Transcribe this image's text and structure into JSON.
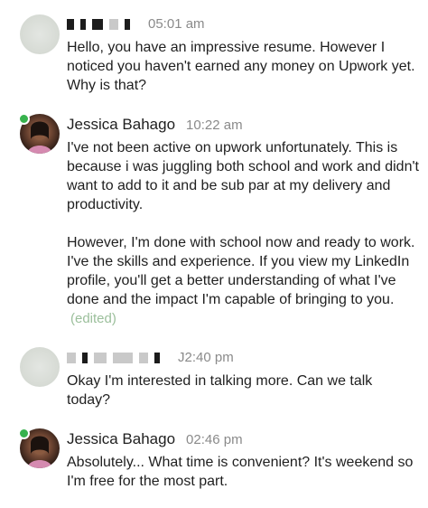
{
  "messages": [
    {
      "sender": "",
      "time": "05:01 am",
      "paragraphs": [
        "Hello, you have an impressive resume. However I noticed you haven't earned any money on Upwork yet. Why is that?"
      ]
    },
    {
      "sender": "Jessica Bahago",
      "time": "10:22 am",
      "paragraphs": [
        "I've not been active on upwork unfortunately. This is because i was juggling both school and work and didn't want to add to it and be sub par at my delivery and productivity.",
        "However, I'm done with school now and ready to work. I've the skills and experience. If you view my LinkedIn profile, you'll get a better understanding of what I've done and the impact I'm capable of bringing to you."
      ],
      "edited_label": "(edited)"
    },
    {
      "sender": "",
      "time": "J2:40 pm",
      "paragraphs": [
        "Okay I'm interested in talking more. Can we talk today?"
      ]
    },
    {
      "sender": "Jessica Bahago",
      "time": "02:46 pm",
      "paragraphs": [
        "Absolutely... What time is convenient? It's weekend so I'm free for the most part."
      ]
    }
  ],
  "colors": {
    "online": "#37b24d",
    "edited": "#9bbf9b",
    "timestamp": "#8a8a8a"
  },
  "icons": {
    "avatar_blurred": "blurred-avatar",
    "avatar_photo": "profile-photo"
  }
}
